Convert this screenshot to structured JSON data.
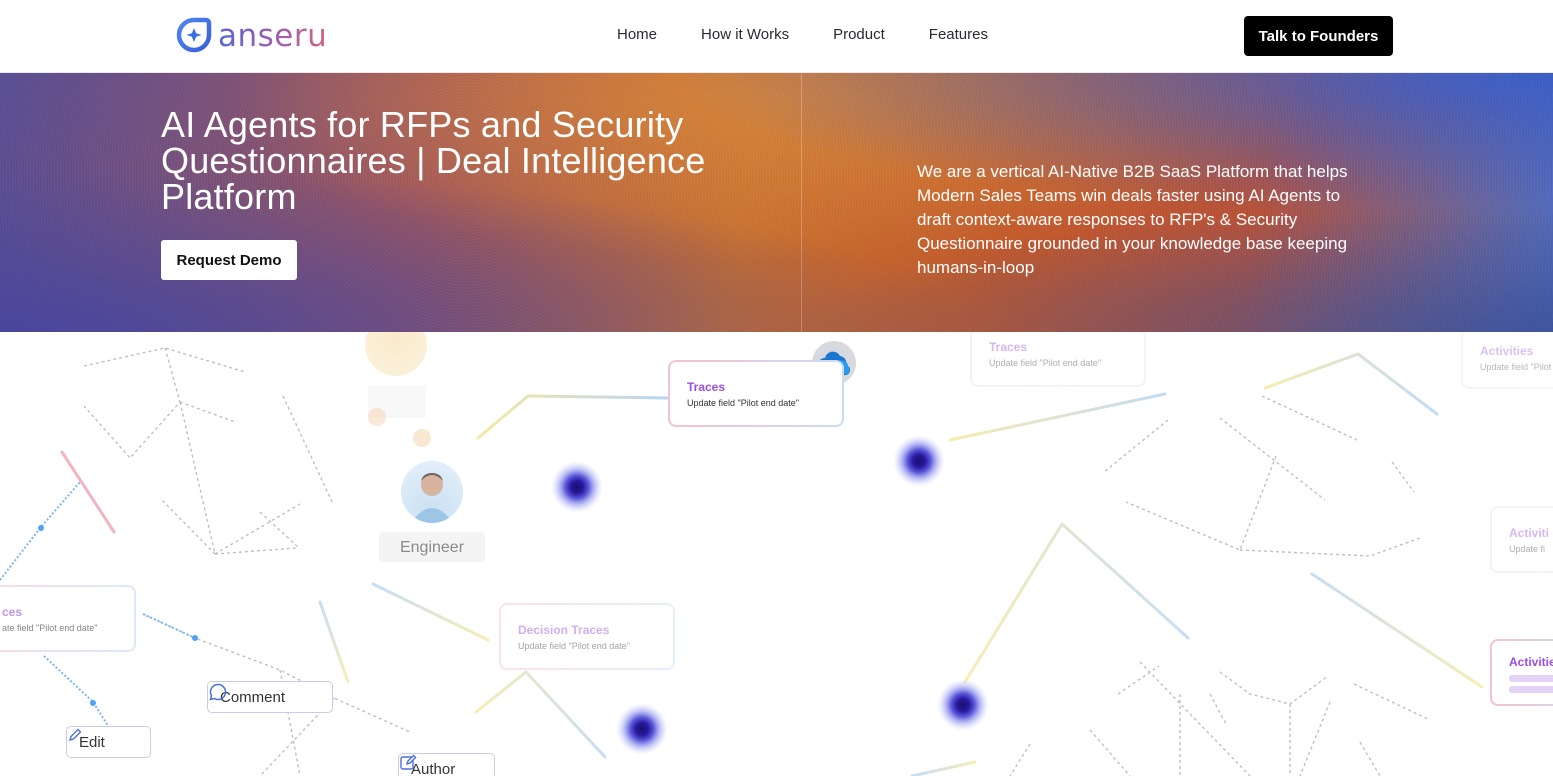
{
  "brand": {
    "logo_text": "anseru"
  },
  "nav": {
    "links": [
      "Home",
      "How it Works",
      "Product",
      "Features"
    ],
    "cta_label": "Talk to Founders"
  },
  "hero": {
    "title": "AI Agents for RFPs and Security Questionnaires | Deal Intelligence Platform",
    "cta_label": "Request Demo",
    "description": "We are a vertical AI-Native B2B SaaS Platform that helps Modern Sales Teams win deals faster using AI Agents to draft context-aware responses to RFP's & Security Questionnaire grounded in your knowledge base keeping humans-in-loop"
  },
  "diagram": {
    "traces_card": {
      "title": "Traces",
      "subtitle": "Update field \"Pilot end date\""
    },
    "faded_traces_card": {
      "title": "Traces",
      "subtitle": "Update field \"Pilot end date\""
    },
    "decision_traces_card": {
      "title": "Decision Traces",
      "subtitle": "Update field \"Pilot end date\""
    },
    "left_card": {
      "title": "ces",
      "subtitle": "ate field \"Pilot end date\""
    },
    "activities_top": {
      "title": "Activities",
      "subtitle": "Update field \"Pilot e"
    },
    "activities_mid": {
      "title": "Activiti",
      "subtitle": "Update fi"
    },
    "activities_bottom": {
      "title": "Activitie"
    },
    "engineer_label": "Engineer",
    "comment_label": "Comment",
    "edit_label": "Edit",
    "author_label": "Author"
  },
  "colors": {
    "brand_blue": "#3b6fe0",
    "brand_gradient_start": "#5a63d6",
    "brand_gradient_end": "#d0667c",
    "trace_purple": "#9b4de0",
    "node_dark": "#1a0f6e"
  }
}
